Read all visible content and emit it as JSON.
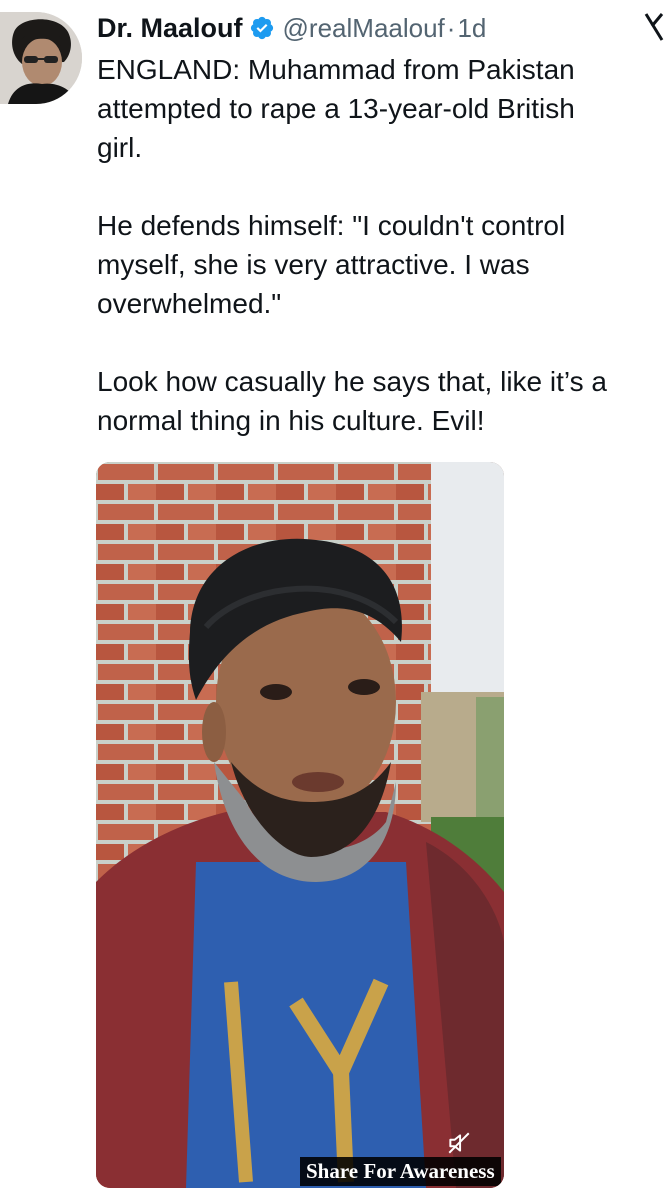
{
  "author": {
    "display_name": "Dr. Maalouf",
    "handle": "@realMaalouf",
    "separator": "·",
    "time": "1d",
    "verified_icon": "verified-badge-icon",
    "avatar_icon": "avatar"
  },
  "tweet": {
    "paragraphs": [
      "ENGLAND: Muhammad from Pakistan\nattempted to rape a 13-year-old British\ngirl.",
      "He defends himself: \"I couldn't control\nmyself, she is very attractive. I was\noverwhelmed.\"",
      "Look how casually he says that, like it’s a\nnormal thing in his culture. Evil!"
    ]
  },
  "media": {
    "caption": "Share For Awareness",
    "mute_icon": "muted-speaker-icon"
  },
  "colors": {
    "accent": "#1d9bf0",
    "secondary_text": "#536471",
    "primary_text": "#0f1419"
  }
}
